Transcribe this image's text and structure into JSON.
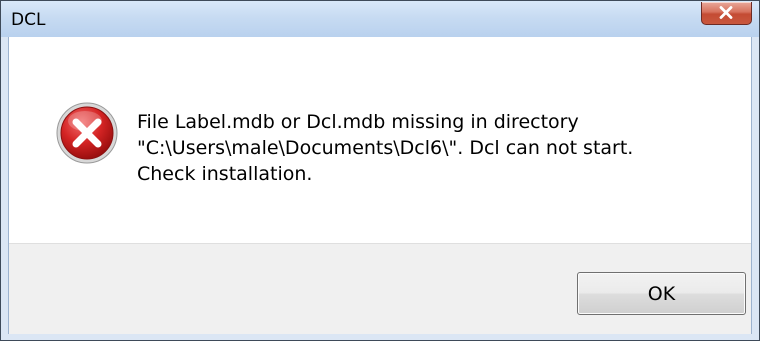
{
  "window": {
    "title": "DCL",
    "close_icon": "close-icon"
  },
  "dialog": {
    "icon": "error-icon",
    "message_lines": [
      "File Label.mdb or Dcl.mdb missing in directory",
      "\"C:\\Users\\male\\Documents\\Dcl6\\\". Dcl can not start.",
      "Check installation."
    ]
  },
  "buttons": {
    "ok_label": "OK"
  },
  "colors": {
    "error_red": "#c81e1e",
    "close_button": "#c9583f",
    "titlebar": "#c7dbf2"
  }
}
